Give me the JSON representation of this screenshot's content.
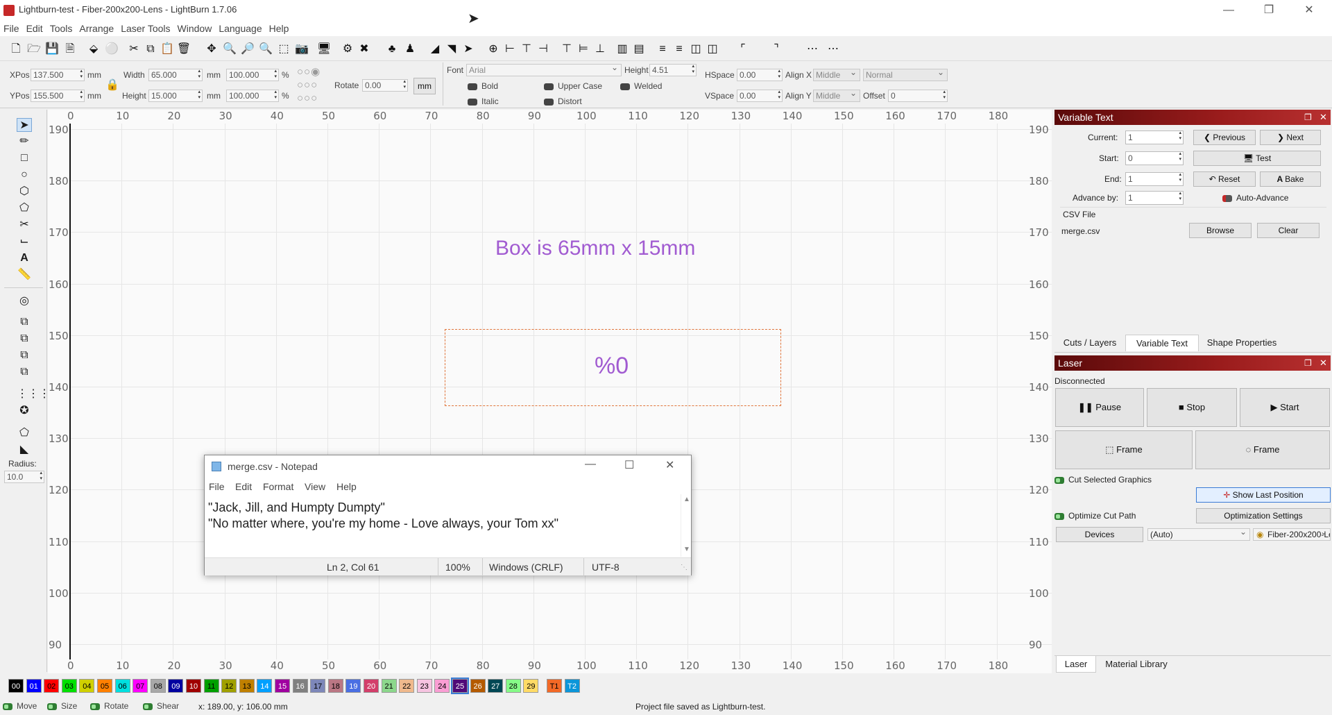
{
  "window": {
    "title": "Lightburn-test - Fiber-200x200-Lens - LightBurn 1.7.06"
  },
  "menu": [
    "File",
    "Edit",
    "Tools",
    "Arrange",
    "Laser Tools",
    "Window",
    "Language",
    "Help"
  ],
  "props": {
    "xpos_label": "XPos",
    "xpos": "137.500",
    "ypos_label": "YPos",
    "ypos": "155.500",
    "unit": "mm",
    "width_label": "Width",
    "width": "65.000",
    "height_label": "Height",
    "height": "15.000",
    "wpct": "100.000",
    "hpct": "100.000",
    "pct": "%",
    "rotate_label": "Rotate",
    "rotate": "0.00",
    "mm_btn": "mm",
    "font_label": "Font",
    "font": "Arial",
    "theight_label": "Height",
    "theight": "4.51",
    "hspace_label": "HSpace",
    "hspace": "0.00",
    "vspace_label": "VSpace",
    "vspace": "0.00",
    "alignx_label": "Align X",
    "alignx": "Middle",
    "aligny_label": "Align Y",
    "aligny": "Middle",
    "normal": "Normal",
    "offset_label": "Offset",
    "offset": "0",
    "bold": "Bold",
    "italic": "Italic",
    "upper": "Upper Case",
    "distort": "Distort",
    "welded": "Welded"
  },
  "radius": {
    "label": "Radius:",
    "value": "10.0"
  },
  "ruler": {
    "x": [
      "0",
      "10",
      "20",
      "30",
      "40",
      "50",
      "60",
      "70",
      "80",
      "90",
      "100",
      "110",
      "120",
      "130",
      "140",
      "150",
      "160",
      "170",
      "180"
    ],
    "y": [
      "190",
      "180",
      "170",
      "160",
      "150",
      "140",
      "130",
      "120",
      "110",
      "100",
      "90"
    ]
  },
  "canvas": {
    "text1": "Box is 65mm x 15mm",
    "text2": "%0"
  },
  "notepad": {
    "title": "merge.csv - Notepad",
    "menu": [
      "File",
      "Edit",
      "Format",
      "View",
      "Help"
    ],
    "line1": "\"Jack, Jill, and Humpty Dumpty\"",
    "line2": "\"No matter where, you're my home - Love always, your Tom xx\"",
    "status_pos": "Ln 2, Col 61",
    "status_zoom": "100%",
    "status_eol": "Windows (CRLF)",
    "status_enc": "UTF-8"
  },
  "vartext": {
    "title": "Variable Text",
    "current_label": "Current:",
    "current": "1",
    "start_label": "Start:",
    "start": "0",
    "end_label": "End:",
    "end": "1",
    "advance_label": "Advance by:",
    "advance": "1",
    "previous": "Previous",
    "next": "Next",
    "test": "Test",
    "reset": "Reset",
    "bake": "Bake",
    "auto_advance": "Auto-Advance",
    "csv_label": "CSV File",
    "csv_file": "merge.csv",
    "browse": "Browse",
    "clear": "Clear"
  },
  "tabs": [
    "Cuts / Layers",
    "Variable Text",
    "Shape Properties"
  ],
  "laser": {
    "title": "Laser",
    "status": "Disconnected",
    "pause": "Pause",
    "stop": "Stop",
    "start": "Start",
    "frame1": "Frame",
    "frame2": "Frame",
    "cut_selected": "Cut Selected Graphics",
    "show_last": "Show Last Position",
    "optimize": "Optimize Cut Path",
    "opt_settings": "Optimization Settings",
    "devices": "Devices",
    "auto": "(Auto)",
    "device": "Fiber-200x200-Le"
  },
  "bottom_tabs": [
    "Laser",
    "Material Library"
  ],
  "colors": [
    {
      "label": "00",
      "bg": "#000000",
      "fg": "#ffffff"
    },
    {
      "label": "01",
      "bg": "#0000ff",
      "fg": "#ffffff"
    },
    {
      "label": "02",
      "bg": "#ff0000",
      "fg": "#000000"
    },
    {
      "label": "03",
      "bg": "#00e000",
      "fg": "#000000"
    },
    {
      "label": "04",
      "bg": "#d0d000",
      "fg": "#000000"
    },
    {
      "label": "05",
      "bg": "#ff8000",
      "fg": "#000000"
    },
    {
      "label": "06",
      "bg": "#00e0e0",
      "fg": "#000000"
    },
    {
      "label": "07",
      "bg": "#ff00ff",
      "fg": "#000000"
    },
    {
      "label": "08",
      "bg": "#a8a8a8",
      "fg": "#000000"
    },
    {
      "label": "09",
      "bg": "#0000a0",
      "fg": "#ffffff"
    },
    {
      "label": "10",
      "bg": "#a00000",
      "fg": "#ffffff"
    },
    {
      "label": "11",
      "bg": "#00a000",
      "fg": "#000000"
    },
    {
      "label": "12",
      "bg": "#a0a000",
      "fg": "#000000"
    },
    {
      "label": "13",
      "bg": "#c08000",
      "fg": "#000000"
    },
    {
      "label": "14",
      "bg": "#00a0ff",
      "fg": "#ffffff"
    },
    {
      "label": "15",
      "bg": "#a000a0",
      "fg": "#ffffff"
    },
    {
      "label": "16",
      "bg": "#808080",
      "fg": "#ffffff"
    },
    {
      "label": "17",
      "bg": "#7d87b9",
      "fg": "#000000"
    },
    {
      "label": "18",
      "bg": "#bb7784",
      "fg": "#000000"
    },
    {
      "label": "19",
      "bg": "#4a6fe3",
      "fg": "#ffffff"
    },
    {
      "label": "20",
      "bg": "#d33f6a",
      "fg": "#ffffff"
    },
    {
      "label": "21",
      "bg": "#8cd78c",
      "fg": "#000000"
    },
    {
      "label": "22",
      "bg": "#f0b98d",
      "fg": "#000000"
    },
    {
      "label": "23",
      "bg": "#f6c4e1",
      "fg": "#000000"
    },
    {
      "label": "24",
      "bg": "#fa9ed4",
      "fg": "#000000"
    },
    {
      "label": "25",
      "bg": "#500a78",
      "fg": "#ffffff"
    },
    {
      "label": "26",
      "bg": "#b45a00",
      "fg": "#ffffff"
    },
    {
      "label": "27",
      "bg": "#004754",
      "fg": "#ffffff"
    },
    {
      "label": "28",
      "bg": "#86fa88",
      "fg": "#000000"
    },
    {
      "label": "29",
      "bg": "#ffdb66",
      "fg": "#000000"
    },
    {
      "label": "T1",
      "bg": "#f36926",
      "fg": "#000000"
    },
    {
      "label": "T2",
      "bg": "#0c96d9",
      "fg": "#ffffff"
    }
  ],
  "status": {
    "move": "Move",
    "size": "Size",
    "rotate": "Rotate",
    "shear": "Shear",
    "coords": "x: 189.00, y: 106.00 mm",
    "message": "Project file saved as Lightburn-test."
  }
}
